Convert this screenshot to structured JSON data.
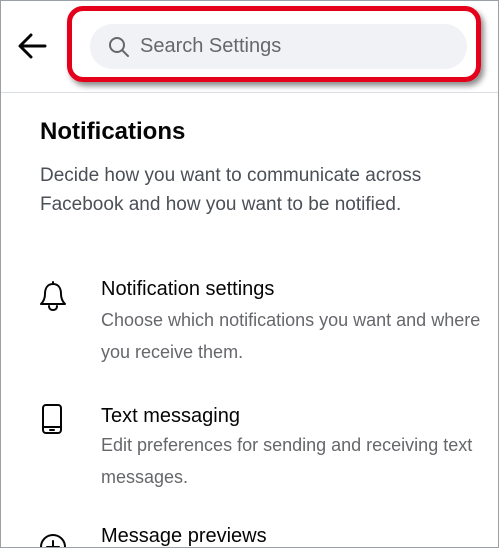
{
  "header": {
    "back_icon": "arrow-left-icon",
    "search": {
      "icon": "search-icon",
      "placeholder": "Search Settings"
    },
    "highlight_color": "#e4001b"
  },
  "section": {
    "title": "Notifications",
    "description": "Decide how you want to communicate across Facebook and how you want to be notified."
  },
  "items": [
    {
      "icon": "bell-icon",
      "title": "Notification settings",
      "description": "Choose which notifications you want and where you receive them."
    },
    {
      "icon": "phone-icon",
      "title": "Text messaging",
      "description": "Edit preferences for sending and receiving text messages."
    },
    {
      "icon": "plus-circle-icon",
      "title": "Message previews",
      "description": ""
    }
  ]
}
